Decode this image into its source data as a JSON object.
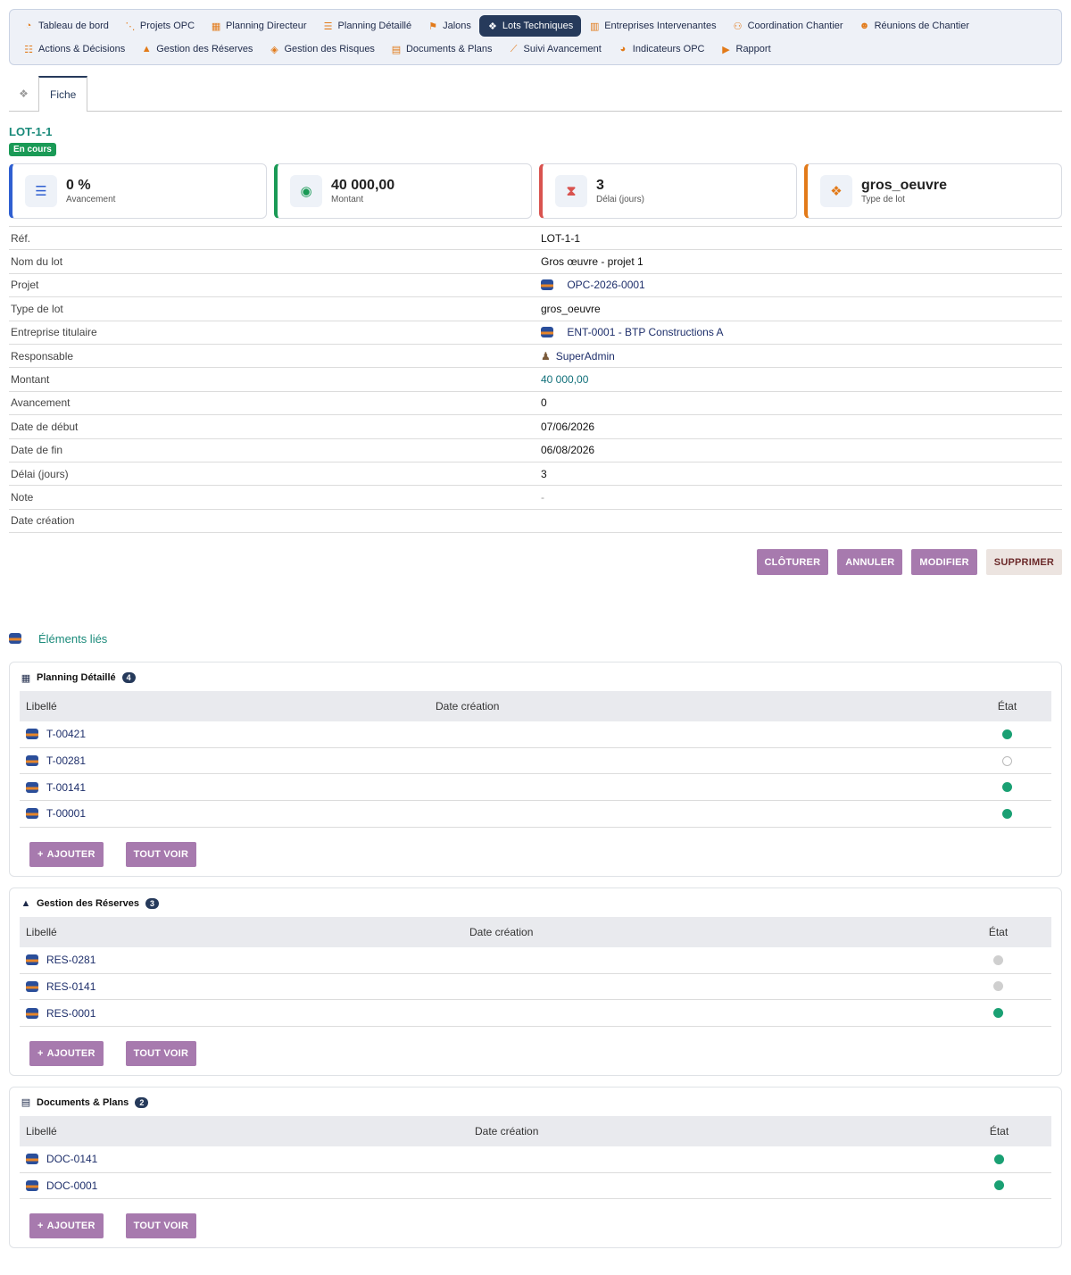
{
  "nav": {
    "row1": [
      {
        "label": "Tableau de bord",
        "icon": "dashboard-icon",
        "glyph": "◔",
        "active": false
      },
      {
        "label": "Projets OPC",
        "icon": "sitemap-icon",
        "glyph": "⋱",
        "active": false
      },
      {
        "label": "Planning Directeur",
        "icon": "calendar-icon",
        "glyph": "▦",
        "active": false
      },
      {
        "label": "Planning Détaillé",
        "icon": "list-icon",
        "glyph": "☰",
        "active": false
      },
      {
        "label": "Jalons",
        "icon": "flag-icon",
        "glyph": "⚑",
        "active": false
      },
      {
        "label": "Lots Techniques",
        "icon": "boxes-icon",
        "glyph": "❖",
        "active": true
      },
      {
        "label": "Entreprises Intervenantes",
        "icon": "building-icon",
        "glyph": "▥",
        "active": false
      },
      {
        "label": "Coordination Chantier",
        "icon": "org-chart-icon",
        "glyph": "⚇",
        "active": false
      },
      {
        "label": "Réunions de Chantier",
        "icon": "users-icon",
        "glyph": "☻",
        "active": false
      }
    ],
    "row2": [
      {
        "label": "Actions & Décisions",
        "icon": "tasks-icon",
        "glyph": "☷",
        "active": false
      },
      {
        "label": "Gestion des Réserves",
        "icon": "warning-icon",
        "glyph": "▲",
        "active": false
      },
      {
        "label": "Gestion des Risques",
        "icon": "shield-icon",
        "glyph": "◈",
        "active": false
      },
      {
        "label": "Documents & Plans",
        "icon": "pdf-file-icon",
        "glyph": "▤",
        "active": false
      },
      {
        "label": "Suivi Avancement",
        "icon": "line-chart-icon",
        "glyph": "⟋",
        "active": false
      },
      {
        "label": "Indicateurs OPC",
        "icon": "pie-chart-icon",
        "glyph": "◕",
        "active": false
      },
      {
        "label": "Rapport",
        "icon": "file-export-icon",
        "glyph": "▶",
        "active": false
      }
    ]
  },
  "tabs": {
    "icon_glyph": "❖",
    "active_label": "Fiche"
  },
  "header": {
    "title": "LOT-1-1",
    "status": "En cours"
  },
  "cards": [
    {
      "value": "0 %",
      "label": "Avancement",
      "icon": "checklist-icon",
      "glyph": "☰",
      "color": "#2f5fd1"
    },
    {
      "value": "40 000,00",
      "label": "Montant",
      "icon": "coins-icon",
      "glyph": "◉",
      "color": "#1a9a56"
    },
    {
      "value": "3",
      "label": "Délai (jours)",
      "icon": "hourglass-icon",
      "glyph": "⧗",
      "color": "#d9534f"
    },
    {
      "value": "gros_oeuvre",
      "label": "Type de lot",
      "icon": "boxes-icon",
      "glyph": "❖",
      "color": "#e27a19"
    }
  ],
  "details": [
    {
      "label": "Réf.",
      "value": "LOT-1-1",
      "kind": "text"
    },
    {
      "label": "Nom du lot",
      "value": "Gros œuvre - projet 1",
      "kind": "text"
    },
    {
      "label": "Projet",
      "value": "OPC-2026-0001",
      "kind": "link"
    },
    {
      "label": "Type de lot",
      "value": "gros_oeuvre",
      "kind": "text"
    },
    {
      "label": "Entreprise titulaire",
      "value": "ENT-0001 - BTP Constructions A",
      "kind": "link"
    },
    {
      "label": "Responsable",
      "value": "SuperAdmin",
      "kind": "user"
    },
    {
      "label": "Montant",
      "value": "40 000,00",
      "kind": "amount"
    },
    {
      "label": "Avancement",
      "value": "0",
      "kind": "text"
    },
    {
      "label": "Date de début",
      "value": "07/06/2026",
      "kind": "text"
    },
    {
      "label": "Date de fin",
      "value": "06/08/2026",
      "kind": "text"
    },
    {
      "label": "Délai (jours)",
      "value": "3",
      "kind": "text"
    },
    {
      "label": "Note",
      "value": "-",
      "kind": "muted"
    },
    {
      "label": "Date création",
      "value": "",
      "kind": "text"
    }
  ],
  "actions": {
    "close": "CLÔTURER",
    "cancel": "ANNULER",
    "edit": "MODIFIER",
    "delete": "SUPPRIMER"
  },
  "linked": {
    "title": "Éléments liés"
  },
  "sections": [
    {
      "title": "Planning Détaillé",
      "count": "4",
      "icon": "calendar-icon",
      "glyph": "▦",
      "cols": [
        "Libellé",
        "Date création",
        "État"
      ],
      "rows": [
        {
          "ref": "T-00421",
          "state": "green"
        },
        {
          "ref": "T-00281",
          "state": "empty"
        },
        {
          "ref": "T-00141",
          "state": "green"
        },
        {
          "ref": "T-00001",
          "state": "green"
        }
      ],
      "add": "AJOUTER",
      "all": "TOUT VOIR"
    },
    {
      "title": "Gestion des Réserves",
      "count": "3",
      "icon": "warning-icon",
      "glyph": "▲",
      "cols": [
        "Libellé",
        "Date création",
        "État"
      ],
      "rows": [
        {
          "ref": "RES-0281",
          "state": "grey"
        },
        {
          "ref": "RES-0141",
          "state": "grey"
        },
        {
          "ref": "RES-0001",
          "state": "green"
        }
      ],
      "add": "AJOUTER",
      "all": "TOUT VOIR"
    },
    {
      "title": "Documents & Plans",
      "count": "2",
      "icon": "pdf-file-icon",
      "glyph": "▤",
      "cols": [
        "Libellé",
        "Date création",
        "État"
      ],
      "rows": [
        {
          "ref": "DOC-0141",
          "state": "green"
        },
        {
          "ref": "DOC-0001",
          "state": "green"
        }
      ],
      "add": "AJOUTER",
      "all": "TOUT VOIR"
    }
  ]
}
